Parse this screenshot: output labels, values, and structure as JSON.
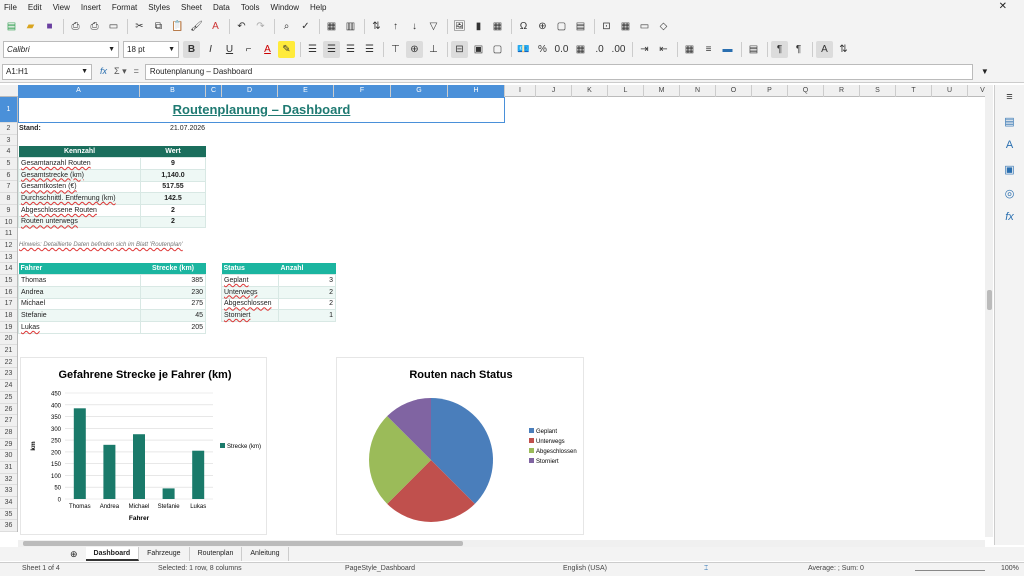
{
  "menu": [
    "File",
    "Edit",
    "View",
    "Insert",
    "Format",
    "Styles",
    "Sheet",
    "Data",
    "Tools",
    "Window",
    "Help"
  ],
  "toolbar": {
    "font_name": "Calibri",
    "font_size": "18 pt"
  },
  "formula": {
    "namebox": "A1:H1",
    "content": "Routenplanung – Dashboard"
  },
  "columns": [
    "A",
    "B",
    "C",
    "D",
    "E",
    "F",
    "G",
    "H",
    "I",
    "J",
    "K",
    "L",
    "M",
    "N",
    "O",
    "P",
    "Q",
    "R",
    "S",
    "T",
    "U",
    "V"
  ],
  "rows": [
    "1",
    "2",
    "3",
    "4",
    "5",
    "6",
    "7",
    "8",
    "9",
    "10",
    "11",
    "12",
    "13",
    "14",
    "15",
    "16",
    "17",
    "18",
    "19",
    "20",
    "21",
    "22",
    "23",
    "24",
    "25",
    "26",
    "27",
    "28",
    "29",
    "30",
    "31",
    "32",
    "33",
    "34",
    "35",
    "36"
  ],
  "sheet": {
    "title": "Routenplanung – Dashboard",
    "stand_label": "Stand:",
    "stand_date": "21.07.2026",
    "kpi_header": [
      "Kennzahl",
      "Wert"
    ],
    "kpis": [
      {
        "label": "Gesamtanzahl Routen",
        "value": "9"
      },
      {
        "label": "Gesamtstrecke (km)",
        "value": "1,140.0"
      },
      {
        "label": "Gesamtkosten (€)",
        "value": "517.55"
      },
      {
        "label": "Durchschnittl. Entfernung (km)",
        "value": "142.5"
      },
      {
        "label": "Abgeschlossene Routen",
        "value": "2"
      },
      {
        "label": "Routen unterwegs",
        "value": "2"
      }
    ],
    "note": "Hinweis: Detaillierte Daten befinden sich im Blatt 'Routenplan'",
    "driver_header": [
      "Fahrer",
      "Strecke (km)"
    ],
    "drivers": [
      {
        "name": "Thomas",
        "km": "385"
      },
      {
        "name": "Andrea",
        "km": "230"
      },
      {
        "name": "Michael",
        "km": "275"
      },
      {
        "name": "Stefanie",
        "km": "45"
      },
      {
        "name": "Lukas",
        "km": "205"
      }
    ],
    "status_header": [
      "Status",
      "Anzahl"
    ],
    "statuses": [
      {
        "name": "Geplant",
        "count": "3"
      },
      {
        "name": "Unterwegs",
        "count": "2"
      },
      {
        "name": "Abgeschlossen",
        "count": "2"
      },
      {
        "name": "Storniert",
        "count": "1"
      }
    ]
  },
  "chart_data": [
    {
      "type": "bar",
      "title": "Gefahrene Strecke je Fahrer (km)",
      "categories": [
        "Thomas",
        "Andrea",
        "Michael",
        "Stefanie",
        "Lukas"
      ],
      "series": [
        {
          "name": "Strecke (km)",
          "values": [
            385,
            230,
            275,
            45,
            205
          ]
        }
      ],
      "xlabel": "Fahrer",
      "ylabel": "km",
      "ylim": [
        0,
        450
      ],
      "yticks": [
        0,
        50,
        100,
        150,
        200,
        250,
        300,
        350,
        400,
        450
      ],
      "color": "#1a7a6a",
      "grid": true,
      "legend": "right"
    },
    {
      "type": "pie",
      "title": "Routen nach Status",
      "labels": [
        "Geplant",
        "Unterwegs",
        "Abgeschlossen",
        "Storniert"
      ],
      "values": [
        3,
        2,
        2,
        1
      ],
      "colors": [
        "#4a7ebb",
        "#c0504d",
        "#9bbb59",
        "#8064a2"
      ],
      "legend": "right"
    }
  ],
  "tabs": [
    "Dashboard",
    "Fahrzeuge",
    "Routenplan",
    "Anleitung"
  ],
  "status": {
    "sheet": "Sheet 1 of 4",
    "selection": "Selected: 1 row, 8 columns",
    "pagestyle": "PageStyle_Dashboard",
    "language": "English (USA)",
    "sum": "Average: ; Sum: 0",
    "zoom": "100%"
  }
}
